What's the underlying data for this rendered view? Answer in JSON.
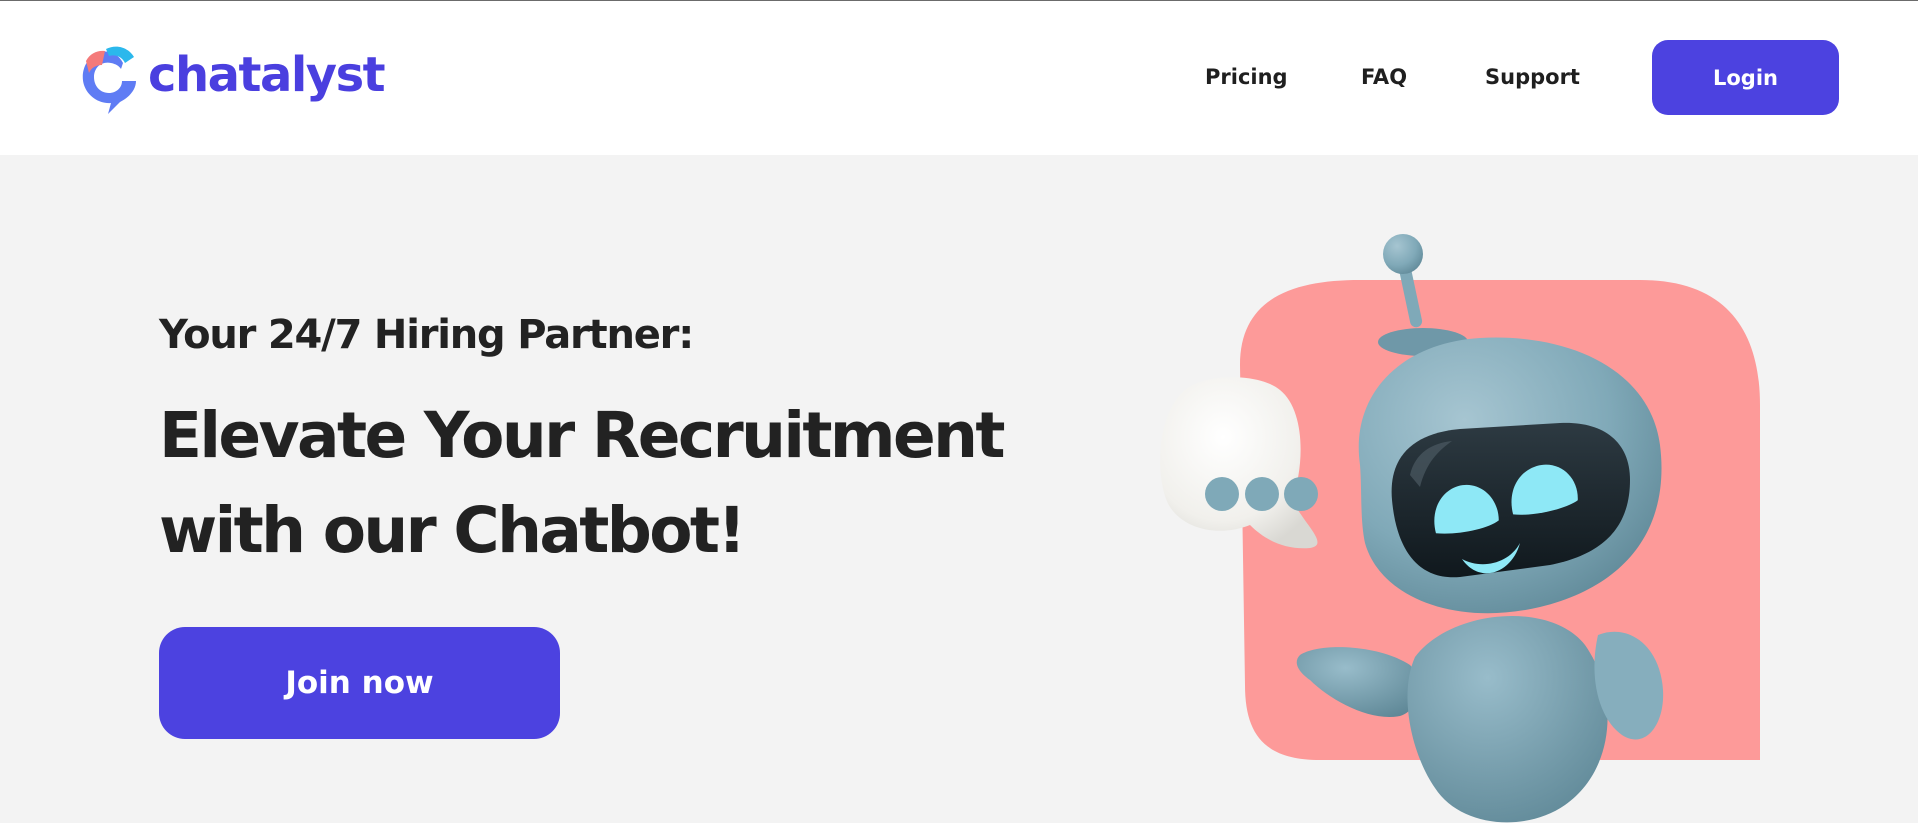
{
  "header": {
    "brand_name": "chatalyst",
    "nav": [
      {
        "label": "Pricing"
      },
      {
        "label": "FAQ"
      },
      {
        "label": "Support"
      }
    ],
    "login_label": "Login"
  },
  "hero": {
    "eyebrow": "Your 24/7 Hiring Partner:",
    "headline_line1": "Elevate Your Recruitment",
    "headline_line2": "with our Chatbot!",
    "cta_label": "Join now"
  },
  "colors": {
    "brand_primary": "#4c42e0",
    "background": "#f3f3f3",
    "illustration_backdrop": "#fd9a99",
    "robot_body": "#7fa9b8",
    "robot_eyes": "#8ee8f6"
  },
  "icons": {
    "logo": "chatalyst-logo-icon",
    "illustration": "robot-chatbot-illustration"
  }
}
